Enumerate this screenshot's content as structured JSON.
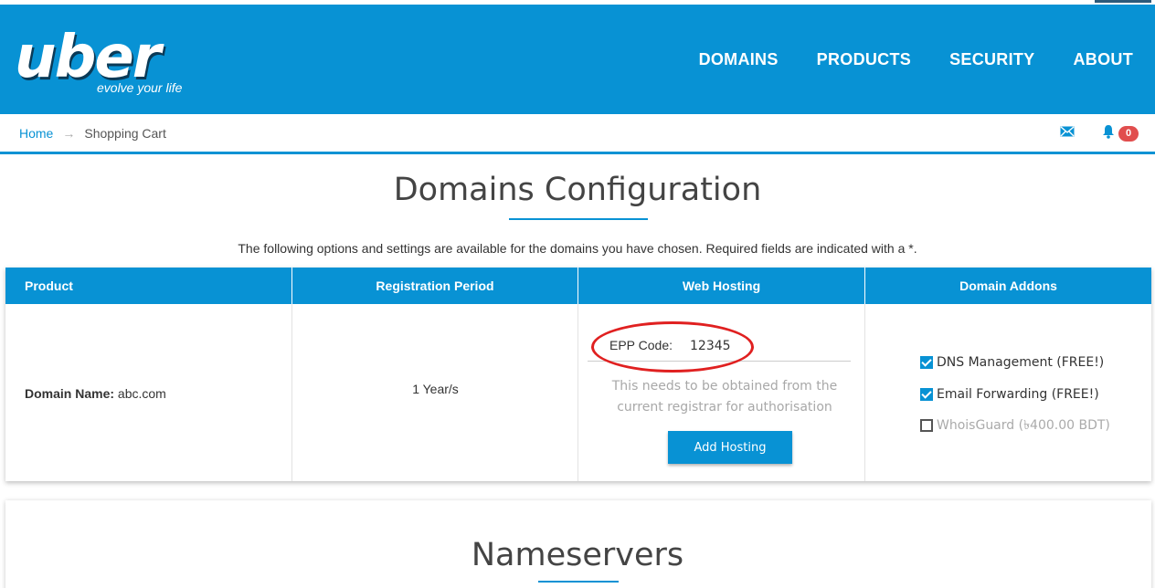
{
  "brand": {
    "logo_word": "uber",
    "tagline": "evolve your life",
    "accent": "#0892d4"
  },
  "nav": {
    "items": [
      "DOMAINS",
      "PRODUCTS",
      "SECURITY",
      "ABOUT"
    ]
  },
  "breadcrumb": {
    "home": "Home",
    "separator": "→",
    "current": "Shopping Cart"
  },
  "header_icons": {
    "mail": "envelope-icon",
    "bell": "bell-icon",
    "notification_count": "0"
  },
  "page": {
    "title": "Domains Configuration",
    "intro": "The following options and settings are available for the domains you have chosen. Required fields are indicated with a *."
  },
  "table": {
    "headers": [
      "Product",
      "Registration Period",
      "Web Hosting",
      "Domain Addons"
    ],
    "row": {
      "domain_label": "Domain Name:",
      "domain_value": "abc.com",
      "period": "1 Year/s",
      "epp_label": "EPP Code:",
      "epp_value": "12345",
      "epp_help": "This needs to be obtained from the current registrar for authorisation",
      "add_hosting": "Add Hosting",
      "addons": [
        {
          "label": "DNS Management (FREE!)",
          "checked": true
        },
        {
          "label": "Email Forwarding (FREE!)",
          "checked": true
        },
        {
          "label": "WhoisGuard (৳400.00 BDT)",
          "checked": false
        }
      ]
    }
  },
  "section2": {
    "title": "Nameservers"
  }
}
